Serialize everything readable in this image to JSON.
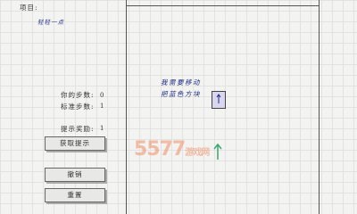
{
  "left_panel": {
    "item_label": "项目:",
    "item_value": "轻轻一点",
    "your_steps_label": "你的步数:",
    "your_steps_value": "0",
    "standard_steps_label": "标准步数:",
    "standard_steps_value": "1",
    "hints_label": "提示奖励:",
    "hints_value": "1",
    "get_hint_button": "获取提示",
    "undo_button": "撤销",
    "reset_button": "重置"
  },
  "board": {
    "hint_line1": "我需要移动",
    "hint_line2": "把蓝色方块"
  },
  "watermark": {
    "brand": "5577",
    "suffix": "游戏网"
  },
  "colors": {
    "ink_blue": "#1f2f86",
    "tile_fill": "#d9d6ee",
    "arrow": "#3aa86b"
  }
}
